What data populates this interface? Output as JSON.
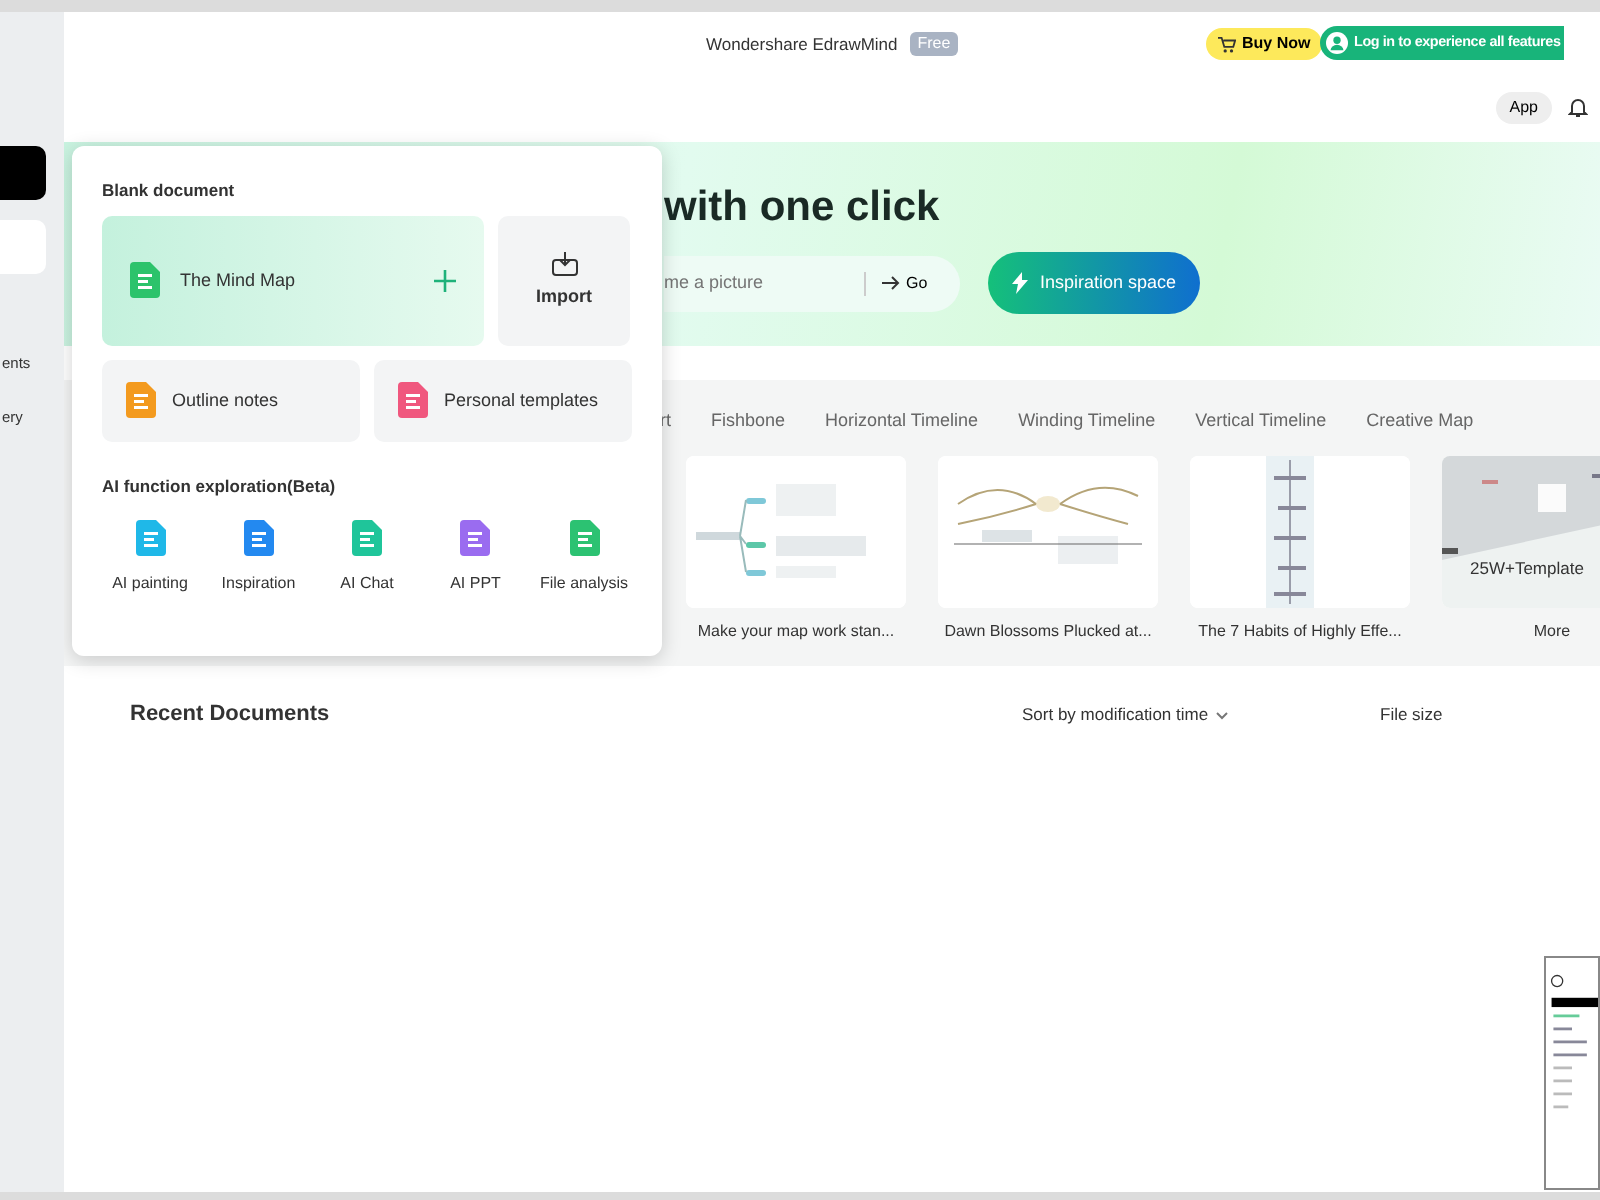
{
  "sidebar": {
    "items": [
      {
        "label": "ents"
      },
      {
        "label": "ery"
      }
    ]
  },
  "header": {
    "title": "Wondershare EdrawMind",
    "badge": "Free",
    "buy_button": "Buy Now",
    "login_button": "Log in to experience all features",
    "app_button": "App"
  },
  "hero": {
    "heading": "with one click",
    "search": {
      "placeholder": "me a picture"
    },
    "go_button": "Go",
    "inspiration_button": "Inspiration space"
  },
  "templates": {
    "tabs": [
      "rt",
      "Fishbone",
      "Horizontal Timeline",
      "Winding Timeline",
      "Vertical Timeline",
      "Creative Map"
    ],
    "cards": [
      {
        "kind": "map",
        "caption": "Make your map work stan..."
      },
      {
        "kind": "radial",
        "caption": "Dawn Blossoms Plucked at..."
      },
      {
        "kind": "vertical",
        "caption": "The 7 Habits of Highly Effe..."
      },
      {
        "kind": "more",
        "overlay": "25W+Template",
        "caption": "More"
      }
    ]
  },
  "recent": {
    "title": "Recent Documents",
    "sort": "Sort by modification time",
    "file_size": "File size"
  },
  "popup": {
    "blank_title": "Blank document",
    "main_item": "The Mind Map",
    "import_button": "Import",
    "items": [
      {
        "label": "Outline notes",
        "color": "#f39a1e"
      },
      {
        "label": "Personal templates",
        "color": "#f0577e"
      }
    ],
    "ai_title": "AI function exploration(Beta)",
    "ai_tools": [
      {
        "label": "AI painting",
        "color": "#1fb8e8"
      },
      {
        "label": "Inspiration",
        "color": "#2389f0"
      },
      {
        "label": "AI Chat",
        "color": "#1fc59a"
      },
      {
        "label": "AI PPT",
        "color": "#9a6cf0"
      },
      {
        "label": "File analysis",
        "color": "#2cc272"
      }
    ]
  }
}
